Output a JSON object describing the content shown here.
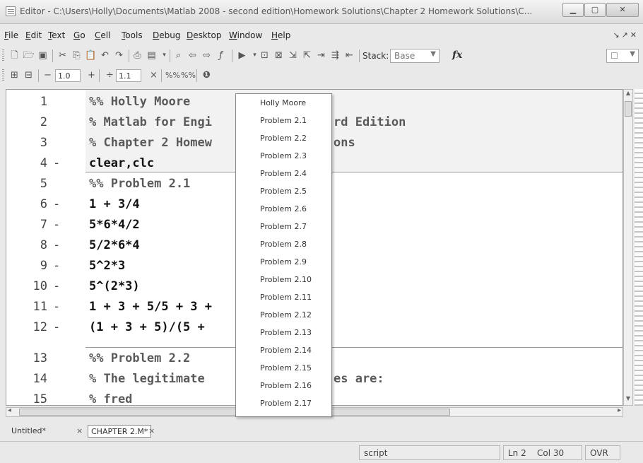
{
  "window": {
    "title": "Editor - C:\\Users\\Holly\\Documents\\Matlab 2008 - second edition\\Homework Solutions\\Chapter 2 Homework Solutions\\C..."
  },
  "menu": [
    "File",
    "Edit",
    "Text",
    "Go",
    "Cell",
    "Tools",
    "Debug",
    "Desktop",
    "Window",
    "Help"
  ],
  "toolbar": {
    "stack_label": "Stack:",
    "stack_value": "Base",
    "cell_step_left": "1.0",
    "cell_step_right": "1.1"
  },
  "editor": {
    "lines": [
      {
        "n": "1",
        "breakpoint": "",
        "text": "%% Holly Moore",
        "kind": "comment"
      },
      {
        "n": "2",
        "breakpoint": "",
        "text": "% Matlab for Engi",
        "kind": "comment"
      },
      {
        "n": "3",
        "breakpoint": "",
        "text": "% Chapter 2 Homew",
        "kind": "comment"
      },
      {
        "n": "4",
        "breakpoint": "-",
        "text": "clear,clc",
        "kind": "stmt"
      },
      {
        "n": "5",
        "breakpoint": "",
        "text": "%% Problem 2.1",
        "kind": "comment"
      },
      {
        "n": "6",
        "breakpoint": "-",
        "text": "1 + 3/4",
        "kind": "stmt"
      },
      {
        "n": "7",
        "breakpoint": "-",
        "text": "5*6*4/2",
        "kind": "stmt"
      },
      {
        "n": "8",
        "breakpoint": "-",
        "text": "5/2*6*4",
        "kind": "stmt"
      },
      {
        "n": "9",
        "breakpoint": "-",
        "text": "5^2*3",
        "kind": "stmt"
      },
      {
        "n": "10",
        "breakpoint": "-",
        "text": "5^(2*3)",
        "kind": "stmt"
      },
      {
        "n": "11",
        "breakpoint": "-",
        "text": "1 + 3 + 5/5 + 3 +",
        "kind": "stmt"
      },
      {
        "n": "12",
        "breakpoint": "-",
        "text": "(1 + 3 + 5)/(5 +",
        "kind": "stmt"
      },
      {
        "n": "13",
        "breakpoint": "",
        "text": "%% Problem 2.2",
        "kind": "comment"
      },
      {
        "n": "14",
        "breakpoint": "",
        "text": "% The legitimate",
        "kind": "comment"
      },
      {
        "n": "15",
        "breakpoint": "",
        "text": "% fred",
        "kind": "comment"
      }
    ],
    "right_fragments": {
      "line2": "rd Edition",
      "line3": "ons",
      "line14": "es are:"
    }
  },
  "cell_dropdown": [
    "Holly Moore",
    "Problem 2.1",
    "Problem 2.2",
    "Problem 2.3",
    "Problem 2.4",
    "Problem 2.5",
    "Problem 2.6",
    "Problem 2.7",
    "Problem 2.8",
    "Problem 2.9",
    "Problem 2.10",
    "Problem 2.11",
    "Problem 2.12",
    "Problem 2.13",
    "Problem 2.14",
    "Problem 2.15",
    "Problem 2.16",
    "Problem 2.17"
  ],
  "tabs": [
    {
      "label": "Untitled*",
      "close": "×"
    },
    {
      "label": "CHAPTER 2.M*",
      "close": "×"
    }
  ],
  "status": {
    "mode": "script",
    "ln_label": "Ln",
    "ln": "2",
    "col_label": "Col",
    "col": "30",
    "ovr": "OVR"
  }
}
